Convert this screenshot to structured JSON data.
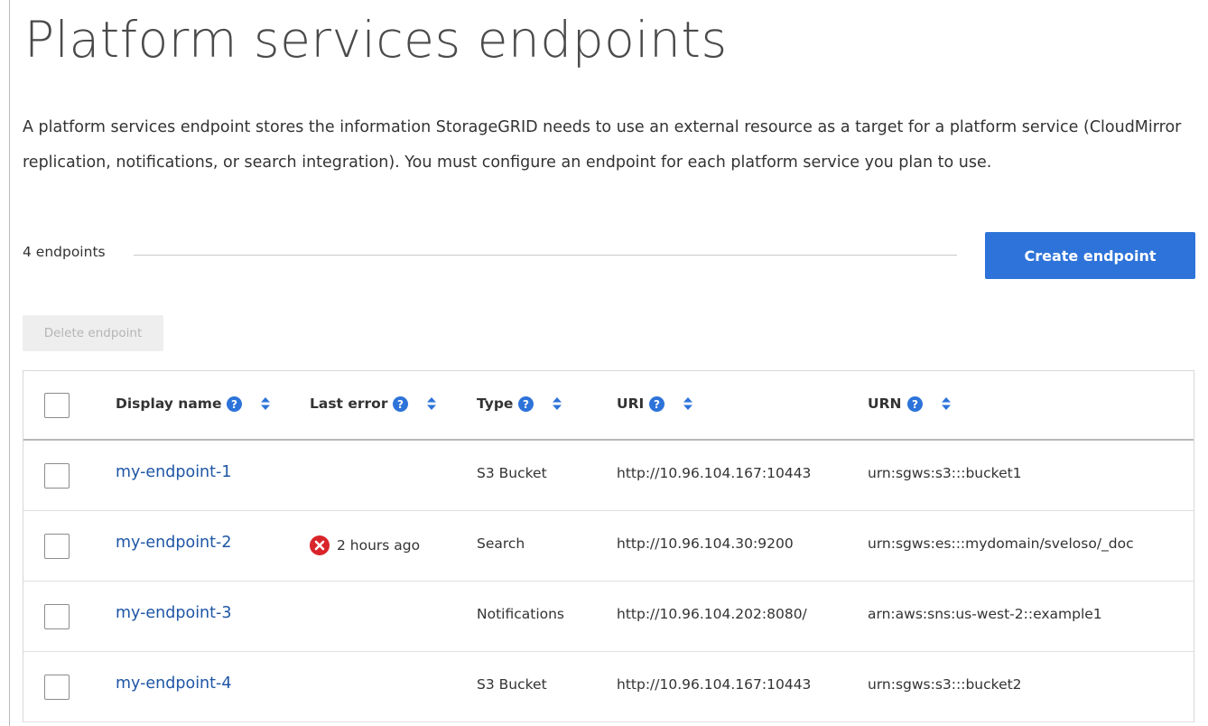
{
  "page": {
    "title": "Platform services endpoints",
    "description": "A platform services endpoint stores the information StorageGRID needs to use an external resource as a target for a platform service (CloudMirror replication, notifications, or search integration). You must configure an endpoint for each platform service you plan to use."
  },
  "toolbar": {
    "count_label": "4 endpoints",
    "create_label": "Create endpoint",
    "delete_label": "Delete endpoint"
  },
  "table": {
    "columns": {
      "display_name": "Display name",
      "last_error": "Last error",
      "type": "Type",
      "uri": "URI",
      "urn": "URN"
    },
    "rows": [
      {
        "name": "my-endpoint-1",
        "last_error": "",
        "type": "S3 Bucket",
        "uri": "http://10.96.104.167:10443",
        "urn": "urn:sgws:s3:::bucket1"
      },
      {
        "name": "my-endpoint-2",
        "last_error": "2 hours ago",
        "type": "Search",
        "uri": "http://10.96.104.30:9200",
        "urn": "urn:sgws:es:::mydomain/sveloso/_doc"
      },
      {
        "name": "my-endpoint-3",
        "last_error": "",
        "type": "Notifications",
        "uri": "http://10.96.104.202:8080/",
        "urn": "arn:aws:sns:us-west-2::example1"
      },
      {
        "name": "my-endpoint-4",
        "last_error": "",
        "type": "S3 Bucket",
        "uri": "http://10.96.104.167:10443",
        "urn": "urn:sgws:s3:::bucket2"
      }
    ]
  },
  "icons": {
    "help": "help-icon",
    "sort": "sort-icon",
    "error": "error-icon"
  },
  "colors": {
    "primary": "#2d73d9",
    "link": "#1f56a6",
    "error": "#d9242b",
    "help": "#2d73d9"
  }
}
